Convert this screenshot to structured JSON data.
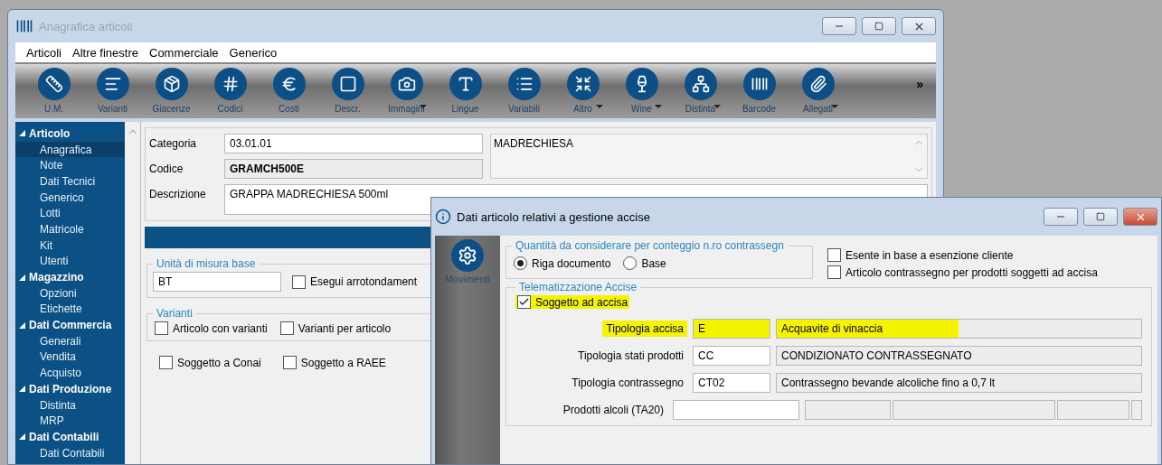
{
  "window": {
    "title": "Anagrafica articoli"
  },
  "menu": [
    "Articoli",
    "Altre finestre",
    "Commerciale",
    "Generico"
  ],
  "toolbar": [
    {
      "label": "U.M.",
      "dropdown": false
    },
    {
      "label": "Varianti",
      "dropdown": false
    },
    {
      "label": "Giacenze",
      "dropdown": false
    },
    {
      "label": "Codici",
      "dropdown": false
    },
    {
      "label": "Costi",
      "dropdown": false
    },
    {
      "label": "Descr.",
      "dropdown": false
    },
    {
      "label": "Immagini",
      "dropdown": true
    },
    {
      "label": "Lingue",
      "dropdown": false
    },
    {
      "label": "Variabili",
      "dropdown": false
    },
    {
      "label": "Altro",
      "dropdown": true
    },
    {
      "label": "Wine",
      "dropdown": true
    },
    {
      "label": "Distinta",
      "dropdown": true
    },
    {
      "label": "Barcode",
      "dropdown": false
    },
    {
      "label": "Allegati",
      "dropdown": true
    }
  ],
  "toolbar_more": "»",
  "sidebar": {
    "items": [
      {
        "label": "Articolo",
        "expanded": true,
        "children": [
          {
            "label": "Anagrafica",
            "selected": true
          },
          {
            "label": "Note",
            "selected": false
          },
          {
            "label": "Dati Tecnici",
            "selected": false
          },
          {
            "label": "Generico",
            "selected": false
          },
          {
            "label": "Lotti",
            "selected": false
          },
          {
            "label": "Matricole",
            "selected": false
          },
          {
            "label": "Kit",
            "selected": false
          },
          {
            "label": "Utenti",
            "selected": false
          }
        ]
      },
      {
        "label": "Magazzino",
        "expanded": true,
        "children": [
          {
            "label": "Opzioni",
            "selected": false
          },
          {
            "label": "Etichette",
            "selected": false
          }
        ]
      },
      {
        "label": "Dati Commercia",
        "expanded": true,
        "children": [
          {
            "label": "Generali",
            "selected": false
          },
          {
            "label": "Vendita",
            "selected": false
          },
          {
            "label": "Acquisto",
            "selected": false
          }
        ]
      },
      {
        "label": "Dati Produzione",
        "expanded": true,
        "children": [
          {
            "label": "Distinta",
            "selected": false
          },
          {
            "label": "MRP",
            "selected": false
          }
        ]
      },
      {
        "label": "Dati Contabili",
        "expanded": true,
        "children": [
          {
            "label": "Dati Contabili",
            "selected": false
          }
        ]
      }
    ]
  },
  "article": {
    "category_label": "Categoria",
    "category": "03.01.01",
    "category_name": "MADRECHIESA",
    "code_label": "Codice",
    "code": "GRAMCH500E",
    "description_label": "Descrizione",
    "description": "GRAPPA MADRECHIESA 500ml"
  },
  "unit_group": {
    "title": "Unità di misura base",
    "value": "BT",
    "rounding": {
      "label": "Esegui arrotondament",
      "checked": false
    }
  },
  "variants_group": {
    "title": "Varianti",
    "options": [
      {
        "label": "Articolo con varianti",
        "checked": false
      },
      {
        "label": "Varianti per articolo",
        "checked": false
      }
    ]
  },
  "extra_options": [
    {
      "label": "Soggetto a Conai",
      "checked": false
    },
    {
      "label": "Soggetto a RAEE",
      "checked": false
    }
  ],
  "dialog": {
    "title": "Dati articolo relativi a gestione accise",
    "side_button": "Movimenti",
    "quantity_group": {
      "title": "Quantità da considerare per conteggio n.ro contrassegn",
      "options": [
        {
          "label": "Riga documento",
          "selected": true
        },
        {
          "label": "Base",
          "selected": false
        }
      ]
    },
    "flags": [
      {
        "label": "Esente in base a esenzione cliente",
        "checked": false
      },
      {
        "label": "Articolo contrassegno per prodotti soggetti ad accisa",
        "checked": false
      }
    ],
    "telematics": {
      "title": "Telematizzazione Accise",
      "subject": {
        "label": "Soggetto ad accisa",
        "checked": true,
        "highlighted": true
      },
      "rows": [
        {
          "label": "Tipologia accisa",
          "code": "E",
          "description": "Acquavite di vinaccia",
          "highlighted": true
        },
        {
          "label": "Tipologia stati prodotti",
          "code": "CC",
          "description": "CONDIZIONATO CONTRASSEGNATO",
          "highlighted": false
        },
        {
          "label": "Tipologia contrassegno",
          "code": "CT02",
          "description": "Contrassegno bevande alcoliche fino a 0,7 lt",
          "highlighted": false
        }
      ],
      "alcohol_label": "Prodotti alcoli (TA20)"
    }
  }
}
